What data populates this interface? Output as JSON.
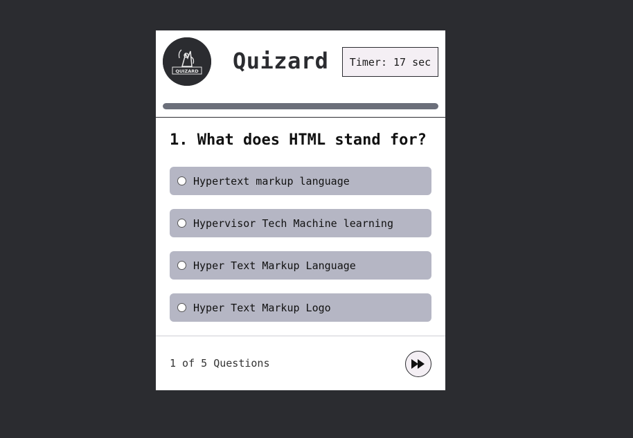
{
  "app": {
    "title": "Quizard",
    "logo_text": "QUIZARD"
  },
  "timer": {
    "label": "Timer: 17 sec"
  },
  "progress": {
    "value": 1.0
  },
  "question": {
    "text": "1. What does HTML stand for?",
    "options": [
      {
        "label": "Hypertext markup language"
      },
      {
        "label": "Hypervisor Tech Machine learning"
      },
      {
        "label": "Hyper Text Markup Language"
      },
      {
        "label": "Hyper Text Markup Logo"
      }
    ]
  },
  "footer": {
    "counter": "1 of 5 Questions",
    "next_icon": "fast-forward-icon"
  },
  "colors": {
    "background": "#2b2c30",
    "card": "#ffffff",
    "option_bg": "#b5b6c4",
    "progress_fill": "#6b6f7a",
    "timer_bg": "#f4eff4"
  }
}
